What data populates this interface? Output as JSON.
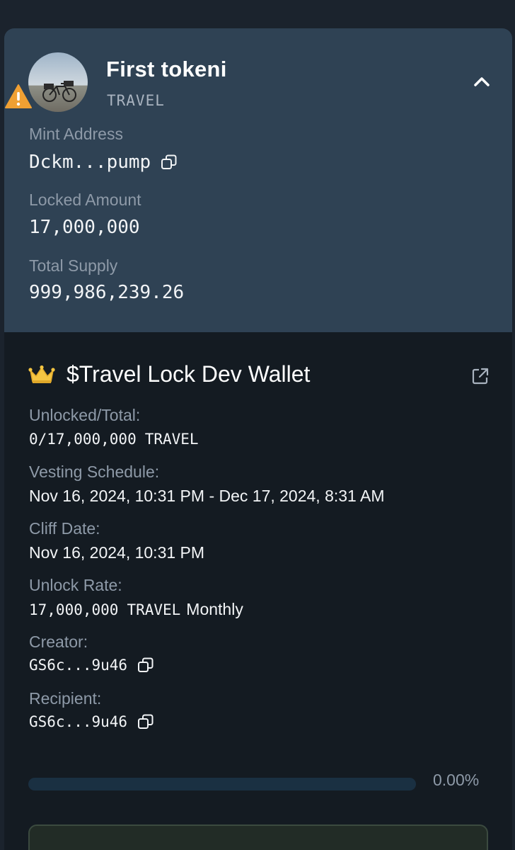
{
  "token": {
    "name": "First tokeni",
    "symbol": "TRAVEL",
    "mint_address_label": "Mint Address",
    "mint_address": "Dckm...pump",
    "locked_amount_label": "Locked Amount",
    "locked_amount": "17,000,000",
    "total_supply_label": "Total Supply",
    "total_supply": "999,986,239.26"
  },
  "lock": {
    "title": "$Travel Lock Dev Wallet",
    "unlocked_label": "Unlocked/Total:",
    "unlocked_amount": "0/17,000,000",
    "unlocked_symbol": "TRAVEL",
    "vesting_label": "Vesting Schedule:",
    "vesting_value": "Nov 16, 2024, 10:31 PM - Dec 17, 2024, 8:31 AM",
    "cliff_label": "Cliff Date:",
    "cliff_value": "Nov 16, 2024, 10:31 PM",
    "rate_label": "Unlock Rate:",
    "rate_amount": "17,000,000",
    "rate_symbol": "TRAVEL",
    "rate_period": "Monthly",
    "creator_label": "Creator:",
    "creator_value": "GS6c...9u46",
    "recipient_label": "Recipient:",
    "recipient_value": "GS6c...9u46",
    "progress_fraction": 0.0,
    "progress_text": "0.00%"
  },
  "icons": {
    "warning": "warning-icon",
    "collapse": "chevron-up-icon",
    "copy": "copy-icon",
    "crown": "crown-icon",
    "external": "external-link-icon"
  },
  "colors": {
    "header_bg": "#2f4254",
    "body_bg": "#141b22",
    "warning": "#f0a033",
    "crown": "#f5c542"
  }
}
